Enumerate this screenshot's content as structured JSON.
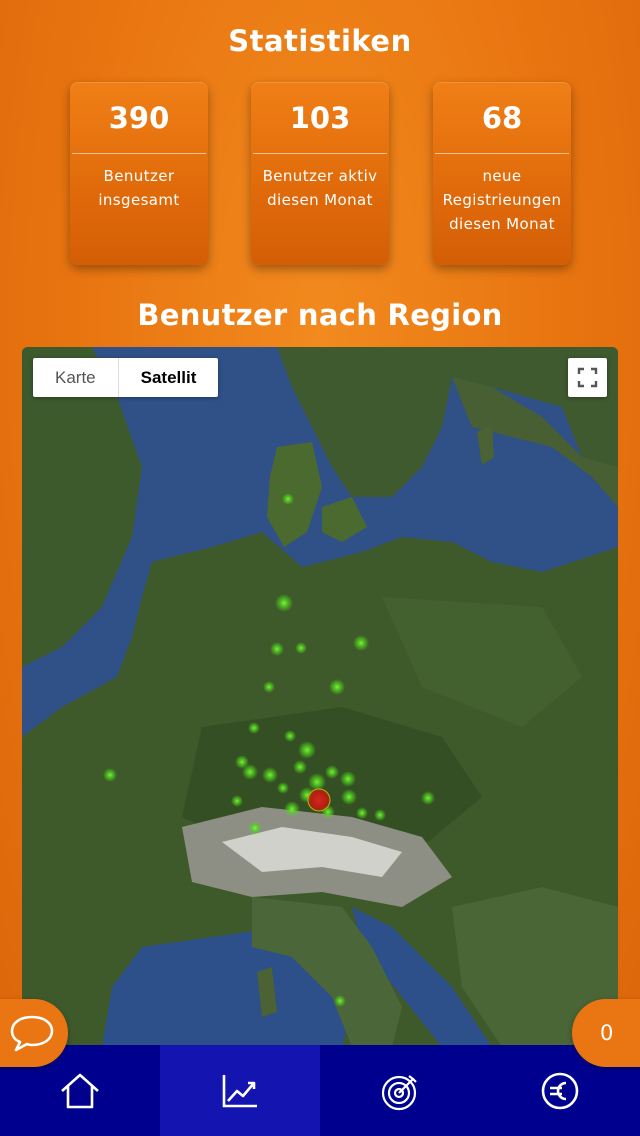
{
  "header": {
    "title": "Statistiken"
  },
  "stats": [
    {
      "value": "390",
      "label": "Benutzer insgesamt"
    },
    {
      "value": "103",
      "label": "Benutzer aktiv diesen Monat"
    },
    {
      "value": "68",
      "label": "neue Registrieungen diesen Monat"
    }
  ],
  "region": {
    "title": "Benutzer nach Region"
  },
  "map": {
    "type_options": [
      "Karte",
      "Satellit"
    ],
    "selected_type": "Satellit",
    "fullscreen_icon": "fullscreen-icon",
    "colors": {
      "water": "#2f5188",
      "land": "#3e5a2a",
      "marker": "#58e02a",
      "hotspot": "#c92a1c"
    }
  },
  "fab": {
    "chat_icon": "speech-bubble-icon",
    "count": "0"
  },
  "nav": {
    "items": [
      {
        "name": "home",
        "icon": "home-icon",
        "active": false
      },
      {
        "name": "statistics",
        "icon": "chart-icon",
        "active": true
      },
      {
        "name": "targets",
        "icon": "target-icon",
        "active": false
      },
      {
        "name": "finance",
        "icon": "euro-icon",
        "active": false
      }
    ]
  },
  "colors": {
    "accent": "#e87410",
    "nav": "#00008f",
    "nav_active": "#1414b0"
  }
}
